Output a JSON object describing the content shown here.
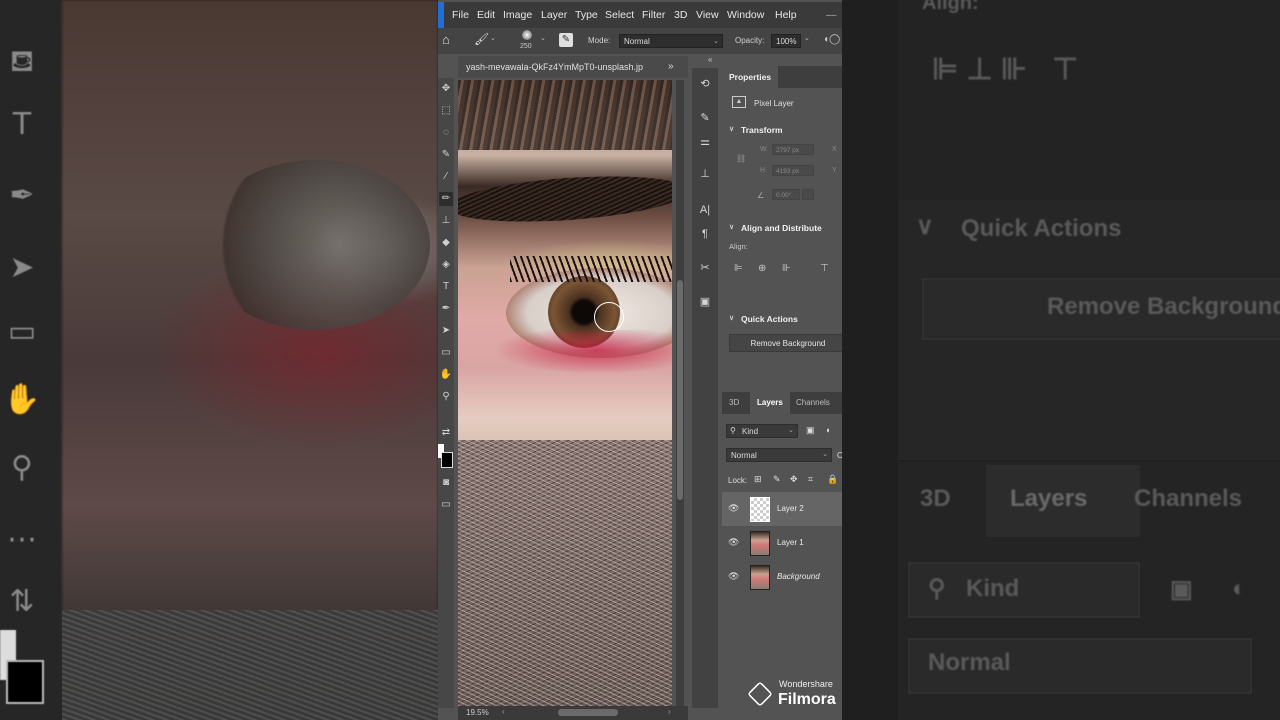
{
  "menu": [
    "File",
    "Edit",
    "Image",
    "Layer",
    "Type",
    "Select",
    "Filter",
    "3D",
    "View",
    "Window",
    "Help"
  ],
  "options": {
    "brush_size": "250",
    "mode_label": "Mode:",
    "mode_value": "Normal",
    "opacity_label": "Opacity:",
    "opacity_value": "100%"
  },
  "document": {
    "tab_title": "yash-mevawala-QkFz4YmMpT0-unsplash.jp",
    "zoom": "19.5%"
  },
  "properties": {
    "tab": "Properties",
    "kind": "Pixel Layer",
    "transform_header": "Transform",
    "w_label": "W",
    "w_value": "2797 px",
    "h_label": "H",
    "h_value": "4193 px",
    "x_label": "X",
    "y_label": "Y",
    "angle_value": "0.00°",
    "align_header": "Align and Distribute",
    "align_label": "Align:",
    "quick_actions_header": "Quick Actions",
    "remove_bg_button": "Remove Background"
  },
  "layers_panel": {
    "tabs": [
      "3D",
      "Layers",
      "Channels"
    ],
    "filter_kind": "Kind",
    "blend_mode": "Normal",
    "lock_label": "Lock:",
    "layers": [
      {
        "name": "Layer 2",
        "selected": true,
        "thumb": "transparent"
      },
      {
        "name": "Layer 1",
        "selected": false,
        "thumb": "photo"
      },
      {
        "name": "Background",
        "selected": false,
        "thumb": "photo"
      }
    ]
  },
  "background_right": {
    "align_title": "Align:",
    "quick_actions": "Quick Actions",
    "remove_bg": "Remove Background",
    "tabs": [
      "3D",
      "Layers",
      "Channels"
    ],
    "kind": "Kind",
    "normal": "Normal"
  },
  "watermark": {
    "line1": "Wondershare",
    "line2": "Filmora"
  }
}
